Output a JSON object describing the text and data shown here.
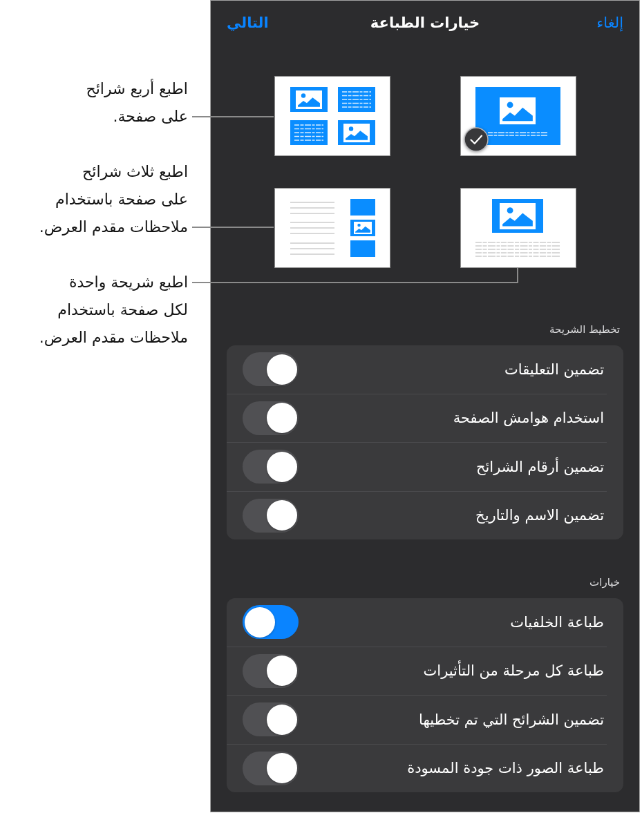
{
  "header": {
    "cancel": "إلغاء",
    "title": "خيارات الطباعة",
    "next": "التالي"
  },
  "callouts": [
    {
      "text": "اطبع أربع شرائح\nعلى صفحة."
    },
    {
      "text": "اطبع ثلاث شرائح\nعلى صفحة باستخدام\nملاحظات مقدم العرض."
    },
    {
      "text": "اطبع شريحة واحدة\nلكل صفحة باستخدام\nملاحظات مقدم العرض."
    }
  ],
  "layouts": [
    {
      "kind": "single",
      "selected": true
    },
    {
      "kind": "four",
      "selected": false
    },
    {
      "kind": "notes",
      "selected": false
    },
    {
      "kind": "three",
      "selected": false
    }
  ],
  "sections": [
    {
      "title": "تخطيط الشريحة",
      "options": [
        {
          "label": "تضمين التعليقات",
          "on": false
        },
        {
          "label": "استخدام هوامش الصفحة",
          "on": false
        },
        {
          "label": "تضمين أرقام الشرائح",
          "on": false
        },
        {
          "label": "تضمين الاسم والتاريخ",
          "on": false
        }
      ]
    },
    {
      "title": "خيارات",
      "options": [
        {
          "label": "طباعة الخلفيات",
          "on": true
        },
        {
          "label": "طباعة كل مرحلة من التأثيرات",
          "on": false
        },
        {
          "label": "تضمين الشرائح التي تم تخطيها",
          "on": false
        },
        {
          "label": "طباعة الصور ذات جودة المسودة",
          "on": false
        }
      ]
    }
  ]
}
